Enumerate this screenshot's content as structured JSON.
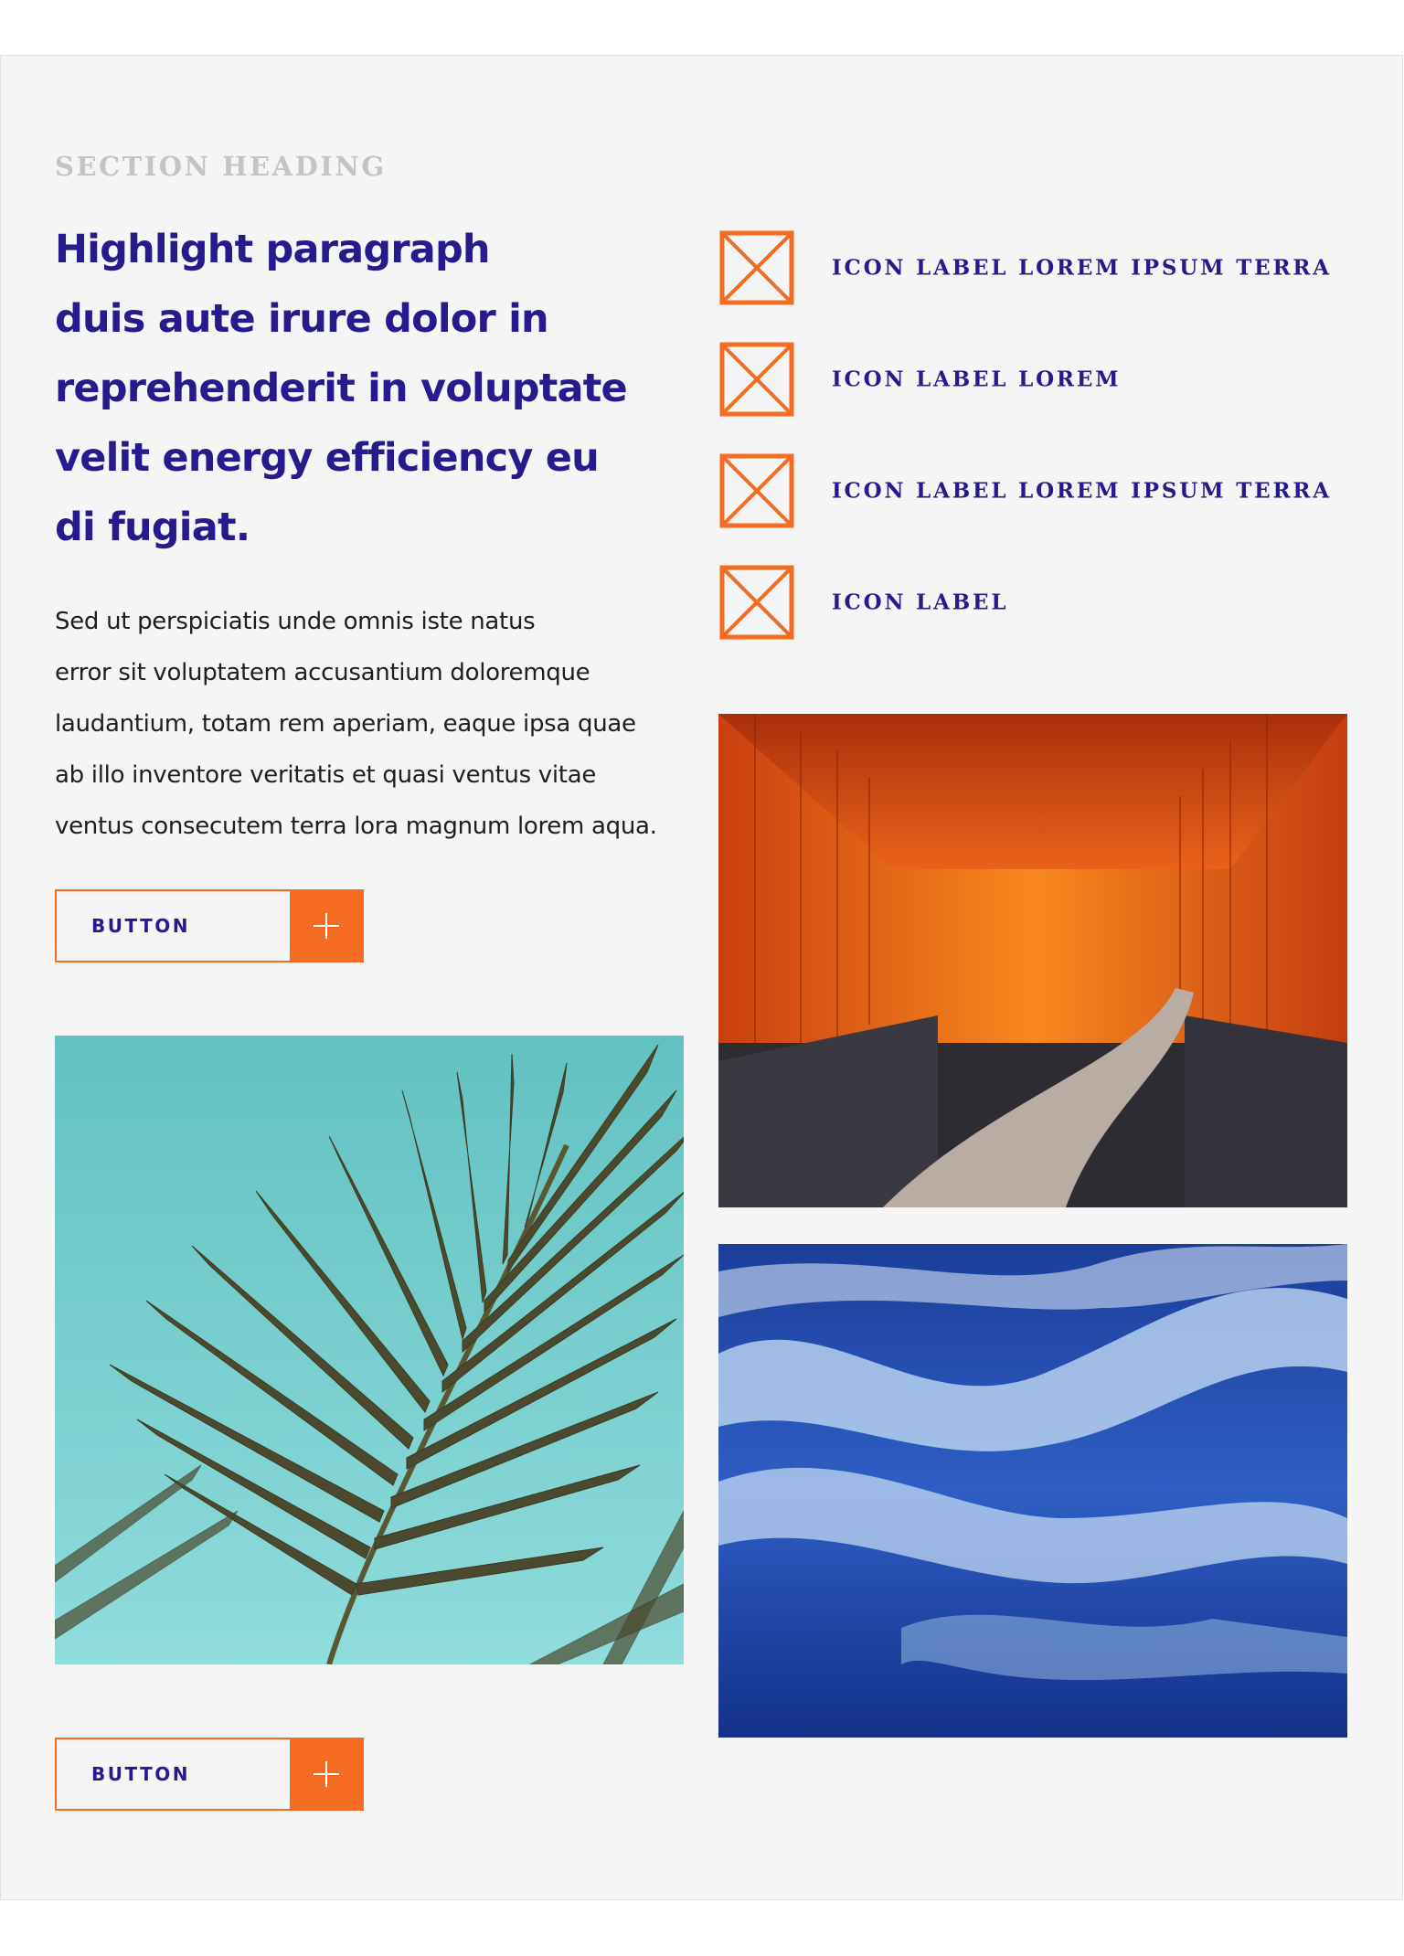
{
  "section": {
    "heading": "SECTION HEADING",
    "highlight_lines": [
      "Highlight paragraph",
      "duis aute irure dolor in",
      "reprehenderit in voluptate",
      "velit energy efficiency eu",
      "di fugiat."
    ],
    "body_lines": [
      "Sed ut perspiciatis unde omnis iste natus",
      "error sit voluptatem accusantium doloremque",
      "laudantium, totam rem aperiam, eaque ipsa quae",
      "ab illo inventore veritatis et quasi ventus vitae",
      "ventus consecutem terra lora magnum lorem aqua."
    ]
  },
  "buttons": [
    {
      "label": "BUTTON",
      "icon": "plus-icon"
    },
    {
      "label": "BUTTON",
      "icon": "plus-icon"
    }
  ],
  "icon_list": [
    {
      "label": "ICON LABEL LOREM IPSUM TERRA",
      "icon": "placeholder-x-icon"
    },
    {
      "label": "ICON LABEL LOREM",
      "icon": "placeholder-x-icon"
    },
    {
      "label": "ICON LABEL LOREM IPSUM TERRA",
      "icon": "placeholder-x-icon"
    },
    {
      "label": "ICON LABEL",
      "icon": "placeholder-x-icon"
    }
  ],
  "images": [
    {
      "subject": "palm-leaf-photo"
    },
    {
      "subject": "torii-gates-photo"
    },
    {
      "subject": "ocean-waves-photo"
    }
  ],
  "colors": {
    "accent": "#f36c21",
    "primary_text": "#271a8c",
    "heading_muted": "#c4c4c4",
    "panel_bg": "#f5f5f5"
  }
}
